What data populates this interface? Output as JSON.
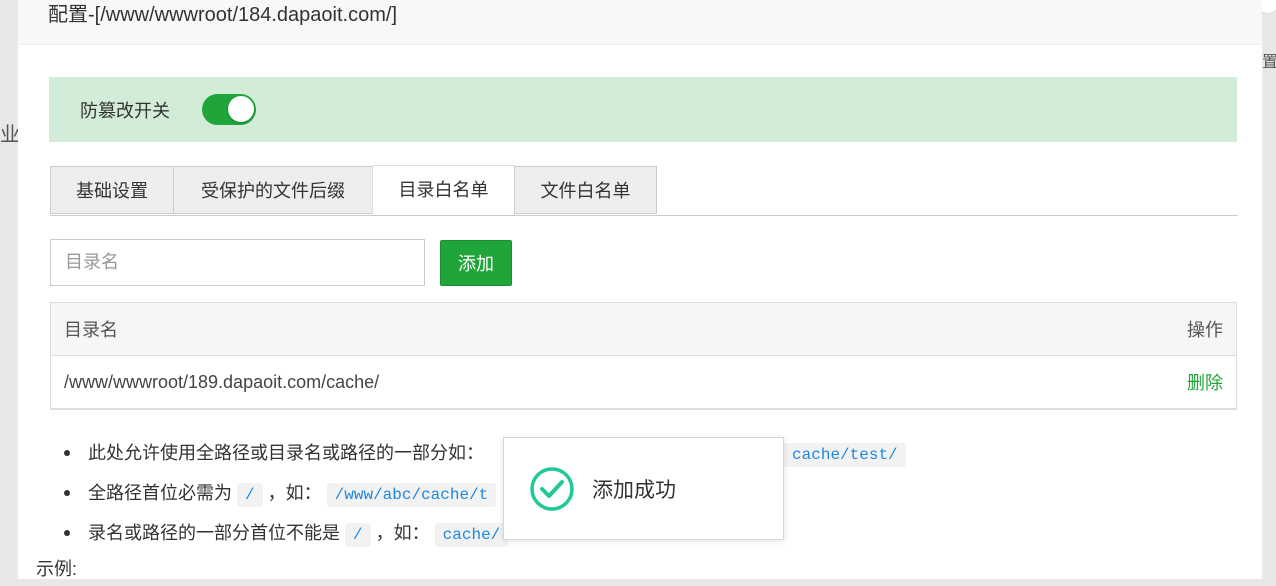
{
  "background": {
    "left_fragment": "业纟",
    "right_fragment": "置"
  },
  "modal": {
    "title": "配置-[/www/wwwroot/184.dapaoit.com/]",
    "switch": {
      "label": "防篡改开关",
      "on": true
    },
    "tabs": [
      {
        "label": "基础设置",
        "active": false
      },
      {
        "label": "受保护的文件后缀",
        "active": false
      },
      {
        "label": "目录白名单",
        "active": true
      },
      {
        "label": "文件白名单",
        "active": false
      }
    ],
    "input": {
      "placeholder": "目录名",
      "value": ""
    },
    "add_button": "添加",
    "table": {
      "headers": {
        "name": "目录名",
        "action": "操作"
      },
      "rows": [
        {
          "path": "/www/wwwroot/189.dapaoit.com/cache/",
          "action": "删除"
        }
      ]
    },
    "notes": [
      {
        "text": "此处允许使用全路径或目录名或路径的一部分如：",
        "code": "cache/test/"
      },
      {
        "text": "全路径首位必需为",
        "code1": "/",
        "mid": "，如：",
        "code2": "/www/abc/cache/t"
      },
      {
        "text": "录名或路径的一部分首位不能是",
        "code1": "/",
        "mid": "，如：",
        "code2": "cache/"
      }
    ],
    "example_label": "示例:"
  },
  "toast": {
    "message": "添加成功",
    "icon": "check-circle-icon",
    "color": "#20c997"
  },
  "colors": {
    "accent": "#20a53a",
    "switch_bar": "#d2ecd8"
  }
}
